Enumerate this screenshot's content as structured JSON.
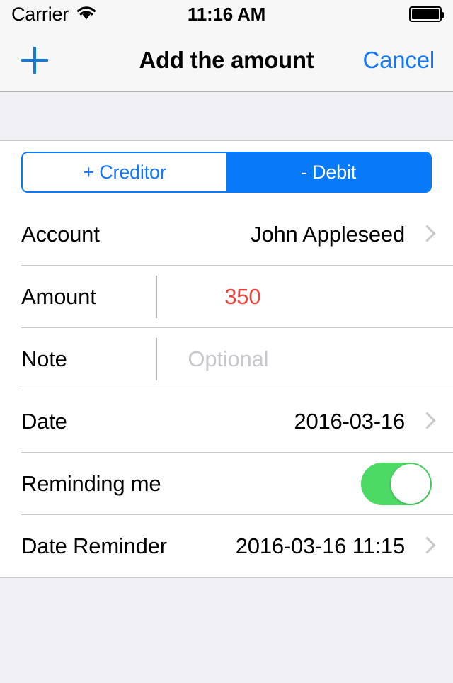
{
  "status_bar": {
    "carrier": "Carrier",
    "wifi_icon": "wifi-icon",
    "time": "11:16 AM",
    "battery_icon": "battery-full-icon"
  },
  "nav_bar": {
    "add_icon": "plus-icon",
    "title": "Add the amount",
    "cancel_label": "Cancel"
  },
  "segmented_control": {
    "options": [
      {
        "label": "+ Creditor",
        "selected": false
      },
      {
        "label": "- Debit",
        "selected": true
      }
    ]
  },
  "form": {
    "rows": [
      {
        "label": "Account",
        "value": "John Appleseed"
      },
      {
        "label": "Amount",
        "value": "350"
      },
      {
        "label": "Note",
        "placeholder": "Optional"
      },
      {
        "label": "Date",
        "value": "2016-03-16"
      },
      {
        "label": "Reminding me",
        "toggle_on": true
      },
      {
        "label": "Date Reminder",
        "value": "2016-03-16 11:15"
      }
    ]
  },
  "colors": {
    "accent_blue": "#077AFA",
    "link_blue": "#1478F6",
    "amount_red": "#E8453C",
    "toggle_green": "#4CD964",
    "placeholder_grey": "#C7C7CD",
    "separator_grey": "#C8C7CC",
    "background_grey": "#EFEFF4",
    "bar_grey": "#F7F7F7"
  }
}
